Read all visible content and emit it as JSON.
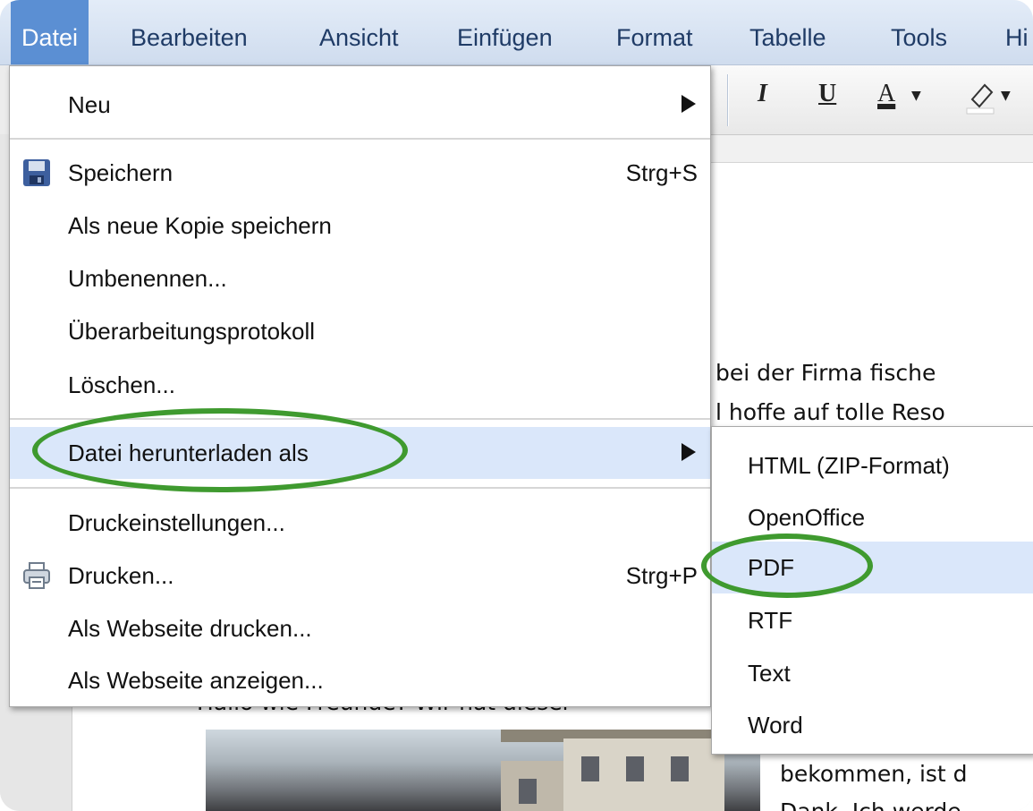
{
  "menubar": {
    "items": [
      "Datei",
      "Bearbeiten",
      "Ansicht",
      "Einfügen",
      "Format",
      "Tabelle",
      "Tools",
      "Hi"
    ]
  },
  "toolbar": {
    "italic": "I",
    "underline": "U",
    "text_color": "A"
  },
  "document": {
    "lines": [
      "bei der Firma fische",
      "l hoffe auf tolle Reso",
      "Hallo wie Freunde? Wir hat dieser",
      "bekommen, ist d",
      "Dank. Ich werde"
    ]
  },
  "file_menu": {
    "new": "Neu",
    "save": "Speichern",
    "save_shortcut": "Strg+S",
    "save_copy": "Als neue Kopie speichern",
    "rename": "Umbenennen...",
    "revision": "Überarbeitungsprotokoll",
    "delete": "Löschen...",
    "download_as": "Datei herunterladen als",
    "print_settings": "Druckeinstellungen...",
    "print": "Drucken...",
    "print_shortcut": "Strg+P",
    "print_webpage": "Als Webseite drucken...",
    "show_webpage": "Als Webseite anzeigen..."
  },
  "download_submenu": {
    "items": [
      "HTML (ZIP-Format)",
      "OpenOffice",
      "PDF",
      "RTF",
      "Text",
      "Word"
    ]
  },
  "colors": {
    "menu_active": "#5b8fd3",
    "highlight": "#dae7fa",
    "annotation": "#3f9a2f"
  }
}
